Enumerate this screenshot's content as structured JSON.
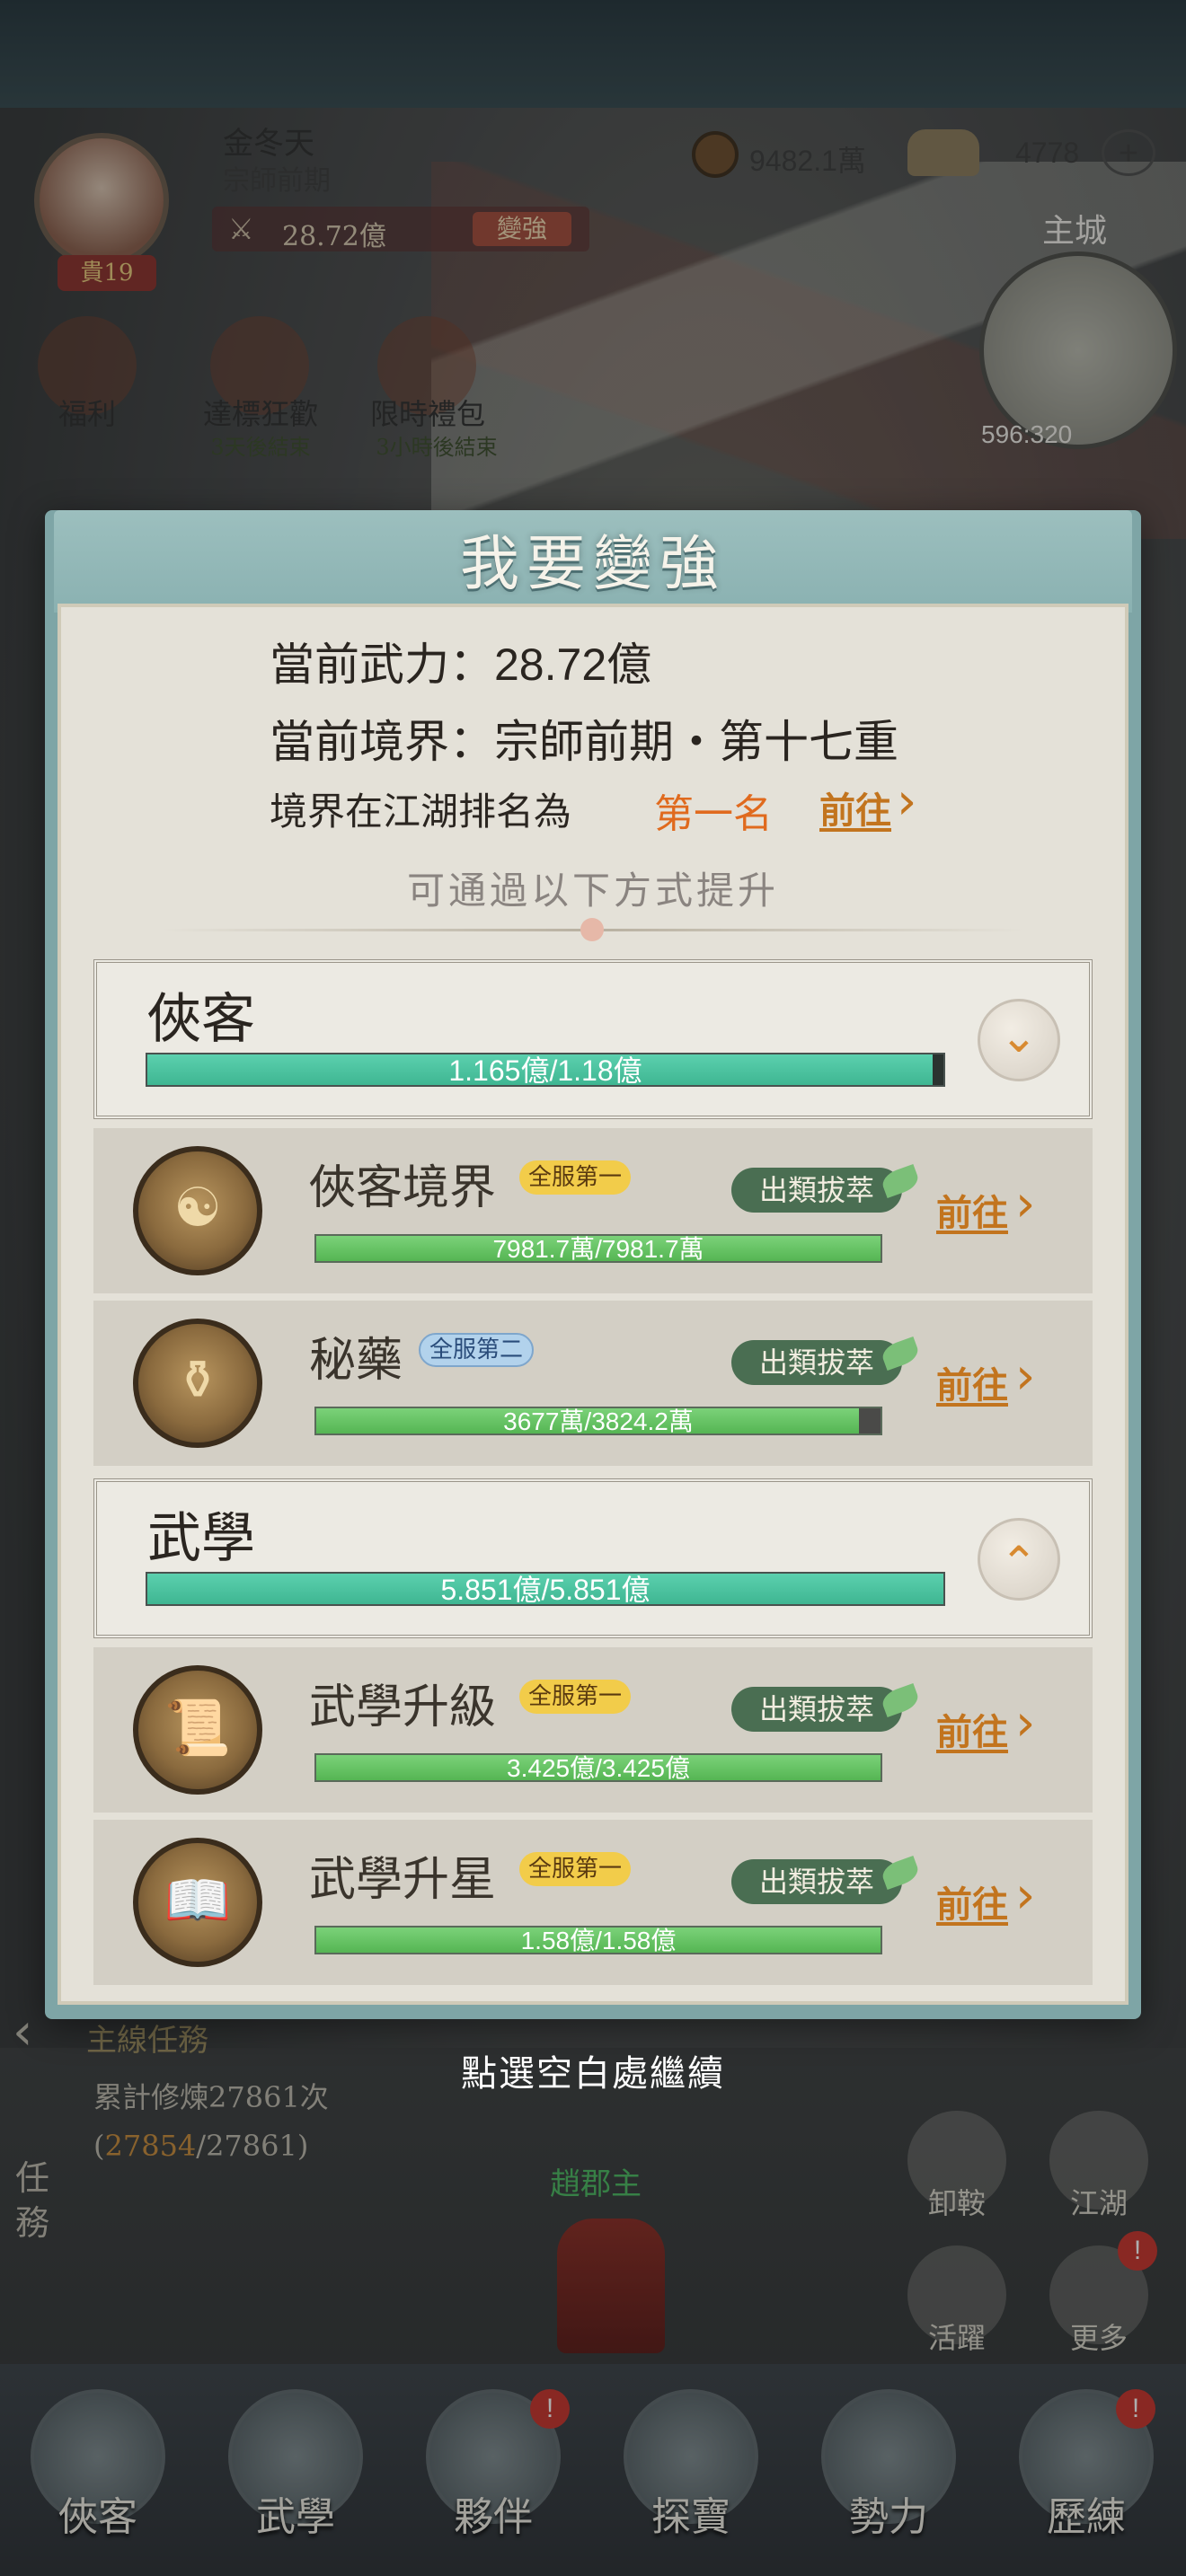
{
  "player": {
    "name": "金冬天",
    "rank": "宗師前期",
    "vip": "貴19",
    "power": "28.72億",
    "strengthen_button": "變強"
  },
  "currency": {
    "coins": "9482.1萬",
    "ingots": "4778",
    "add_symbol": "+"
  },
  "map": {
    "city_label": "主城",
    "coord": "596:320"
  },
  "hud_buttons": [
    {
      "label": "福利",
      "sub": ""
    },
    {
      "label": "達標狂歡",
      "sub": "3天後結束"
    },
    {
      "label": "限時禮包",
      "sub": "3小時後結束"
    }
  ],
  "modal": {
    "title": "我要變強",
    "power_label": "當前武力：",
    "power_value": "28.72億",
    "realm_label": "當前境界：",
    "realm_value": "宗師前期・第十七重",
    "rank_label": "境界在江湖排名為",
    "rank_value": "第一名",
    "goto_label": "前往",
    "hint": "可通過以下方式提升",
    "categories": [
      {
        "title": "俠客",
        "progress_text": "1.165億/1.18億",
        "progress": 0.987,
        "expanded": false
      },
      {
        "title": "武學",
        "progress_text": "5.851億/5.851億",
        "progress": 1.0,
        "expanded": true
      }
    ],
    "items": [
      {
        "name": "俠客境界",
        "badge": "全服第一",
        "badge_type": "gold",
        "tag": "出類拔萃",
        "progress_text": "7981.7萬/7981.7萬",
        "progress": 1.0,
        "goto": "前往",
        "icon": "meditating-hero-icon"
      },
      {
        "name": "秘藥",
        "badge": "全服第二",
        "badge_type": "blue",
        "tag": "出類拔萃",
        "progress_text": "3677萬/3824.2萬",
        "progress": 0.961,
        "goto": "前往",
        "icon": "gourd-icon"
      },
      {
        "name": "武學升級",
        "badge": "全服第一",
        "badge_type": "gold",
        "tag": "出類拔萃",
        "progress_text": "3.425億/3.425億",
        "progress": 1.0,
        "goto": "前往",
        "icon": "scroll-icon"
      },
      {
        "name": "武學升星",
        "badge": "全服第一",
        "badge_type": "gold",
        "tag": "出類拔萃",
        "progress_text": "1.58億/1.58億",
        "progress": 1.0,
        "goto": "前往",
        "icon": "book-icon"
      }
    ],
    "continue_hint": "點選空白處繼續"
  },
  "quest": {
    "title": "主線任務",
    "progress_prefix": "累計修煉27861次(",
    "progress_current": "27854",
    "progress_suffix": "/27861)",
    "tab_label": "任務"
  },
  "npc": {
    "name": "趙郡主"
  },
  "side_buttons": [
    {
      "label": "卸鞍"
    },
    {
      "label": "江湖"
    },
    {
      "label": "活躍"
    },
    {
      "label": "更多",
      "badge": "!"
    }
  ],
  "nav": [
    {
      "label": "俠客",
      "badge": ""
    },
    {
      "label": "武學",
      "badge": ""
    },
    {
      "label": "夥伴",
      "badge": "!"
    },
    {
      "label": "探寶",
      "badge": ""
    },
    {
      "label": "勢力",
      "badge": ""
    },
    {
      "label": "歷練",
      "badge": "!"
    }
  ]
}
